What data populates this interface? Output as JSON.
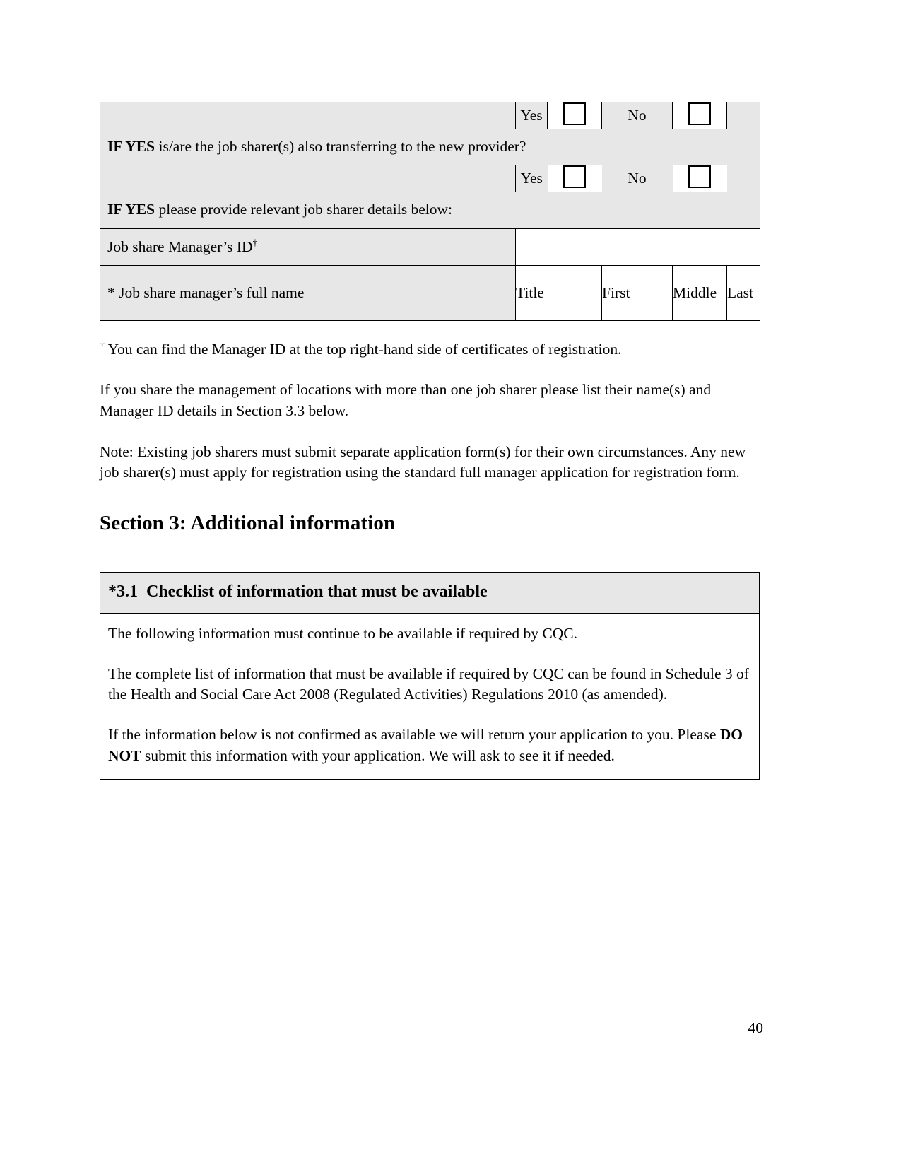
{
  "document": {
    "page_number": "40"
  },
  "form_table": {
    "rows": [
      {
        "type": "yesno",
        "yes_label": "Yes",
        "no_label": "No"
      },
      {
        "type": "question",
        "bold_prefix": "IF YES",
        "text": " is/are the job sharer(s) also transferring to the new provider?"
      },
      {
        "type": "yesno",
        "yes_label": "Yes",
        "no_label": "No"
      },
      {
        "type": "question",
        "bold_prefix": "IF YES",
        "text": " please provide relevant job sharer details below:"
      }
    ],
    "manager_id_row": {
      "label": "Job share Manager’s ID",
      "superscript": "†",
      "value": ""
    },
    "full_name_row": {
      "label": "* Job share manager’s full name",
      "columns": [
        {
          "header": "Title",
          "value": ""
        },
        {
          "header": "First",
          "value": ""
        },
        {
          "header": "Middle",
          "value": ""
        },
        {
          "header": "Last",
          "value": ""
        }
      ]
    }
  },
  "footnote": {
    "marker": "†",
    "text": " You can find the Manager ID at the top right-hand side of certificates of registration."
  },
  "paragraphs": [
    "If you share the management of locations with more than one job sharer please list their name(s) and Manager ID details in Section 3.3 below.",
    "Note: Existing job sharers must submit separate application form(s) for their own circumstances. Any new job sharer(s) must apply for registration using the standard full manager application for registration form."
  ],
  "section_heading": "Section 3: Additional information",
  "checklist": {
    "number": "*3.1",
    "title": "Checklist of information that must be available",
    "paragraph_1": "The following information must continue to be available if required by CQC.",
    "paragraph_2": "The complete list of information that must be available if required by CQC can be found in Schedule 3 of the Health and Social Care Act 2008 (Regulated Activities) Regulations 2010 (as amended).",
    "paragraph_3_part_1": "If the information below is not confirmed as available we will return your application to you. Please ",
    "paragraph_3_bold": "DO NOT",
    "paragraph_3_part_2": " submit this information with your application. We will ask to see it if needed."
  },
  "colors": {
    "shaded_cell": "#e7e7e7",
    "border": "#000000",
    "page_background": "#ffffff"
  }
}
